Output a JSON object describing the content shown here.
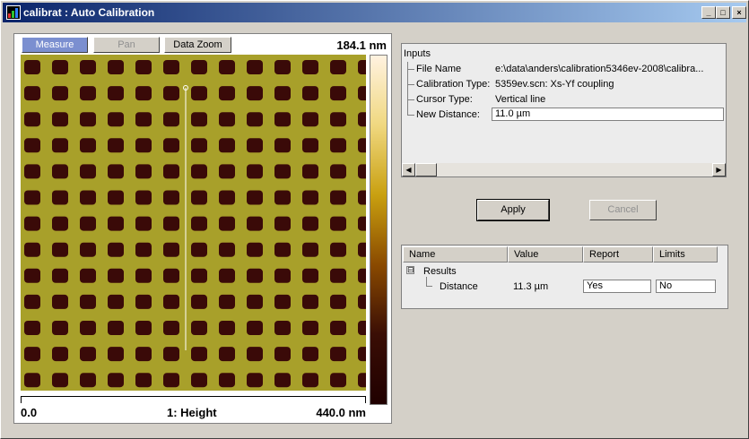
{
  "window": {
    "title": "calibrat : Auto Calibration",
    "controls": {
      "minimize": "_",
      "maximize": "□",
      "close": "×"
    }
  },
  "image_panel": {
    "buttons": {
      "measure": "Measure",
      "pan": "Pan",
      "data_zoom": "Data Zoom"
    },
    "scale_max": "184.1 nm",
    "axis_min": "0.0",
    "axis_title": "1: Height",
    "axis_max": "440.0 nm",
    "colors": {
      "background": "#a8a02a",
      "hole": "#3a0a08",
      "cursor_line": "#ffffff"
    }
  },
  "inputs": {
    "header": "Inputs",
    "rows": [
      {
        "label": "File Name",
        "value": "e:\\data\\anders\\calibration5346ev-2008\\calibra..."
      },
      {
        "label": "Calibration Type:",
        "value": "5359ev.scn: Xs-Yf coupling"
      },
      {
        "label": "Cursor Type:",
        "value": "Vertical line"
      },
      {
        "label": "New Distance:",
        "value": "11.0 µm"
      }
    ]
  },
  "actions": {
    "apply": "Apply",
    "cancel": "Cancel"
  },
  "results": {
    "columns": [
      "Name",
      "Value",
      "Report",
      "Limits"
    ],
    "tree_toggle": "⊟",
    "group": "Results",
    "row": {
      "name": "Distance",
      "value": "11.3 µm",
      "report": "Yes",
      "limits": "No"
    }
  }
}
